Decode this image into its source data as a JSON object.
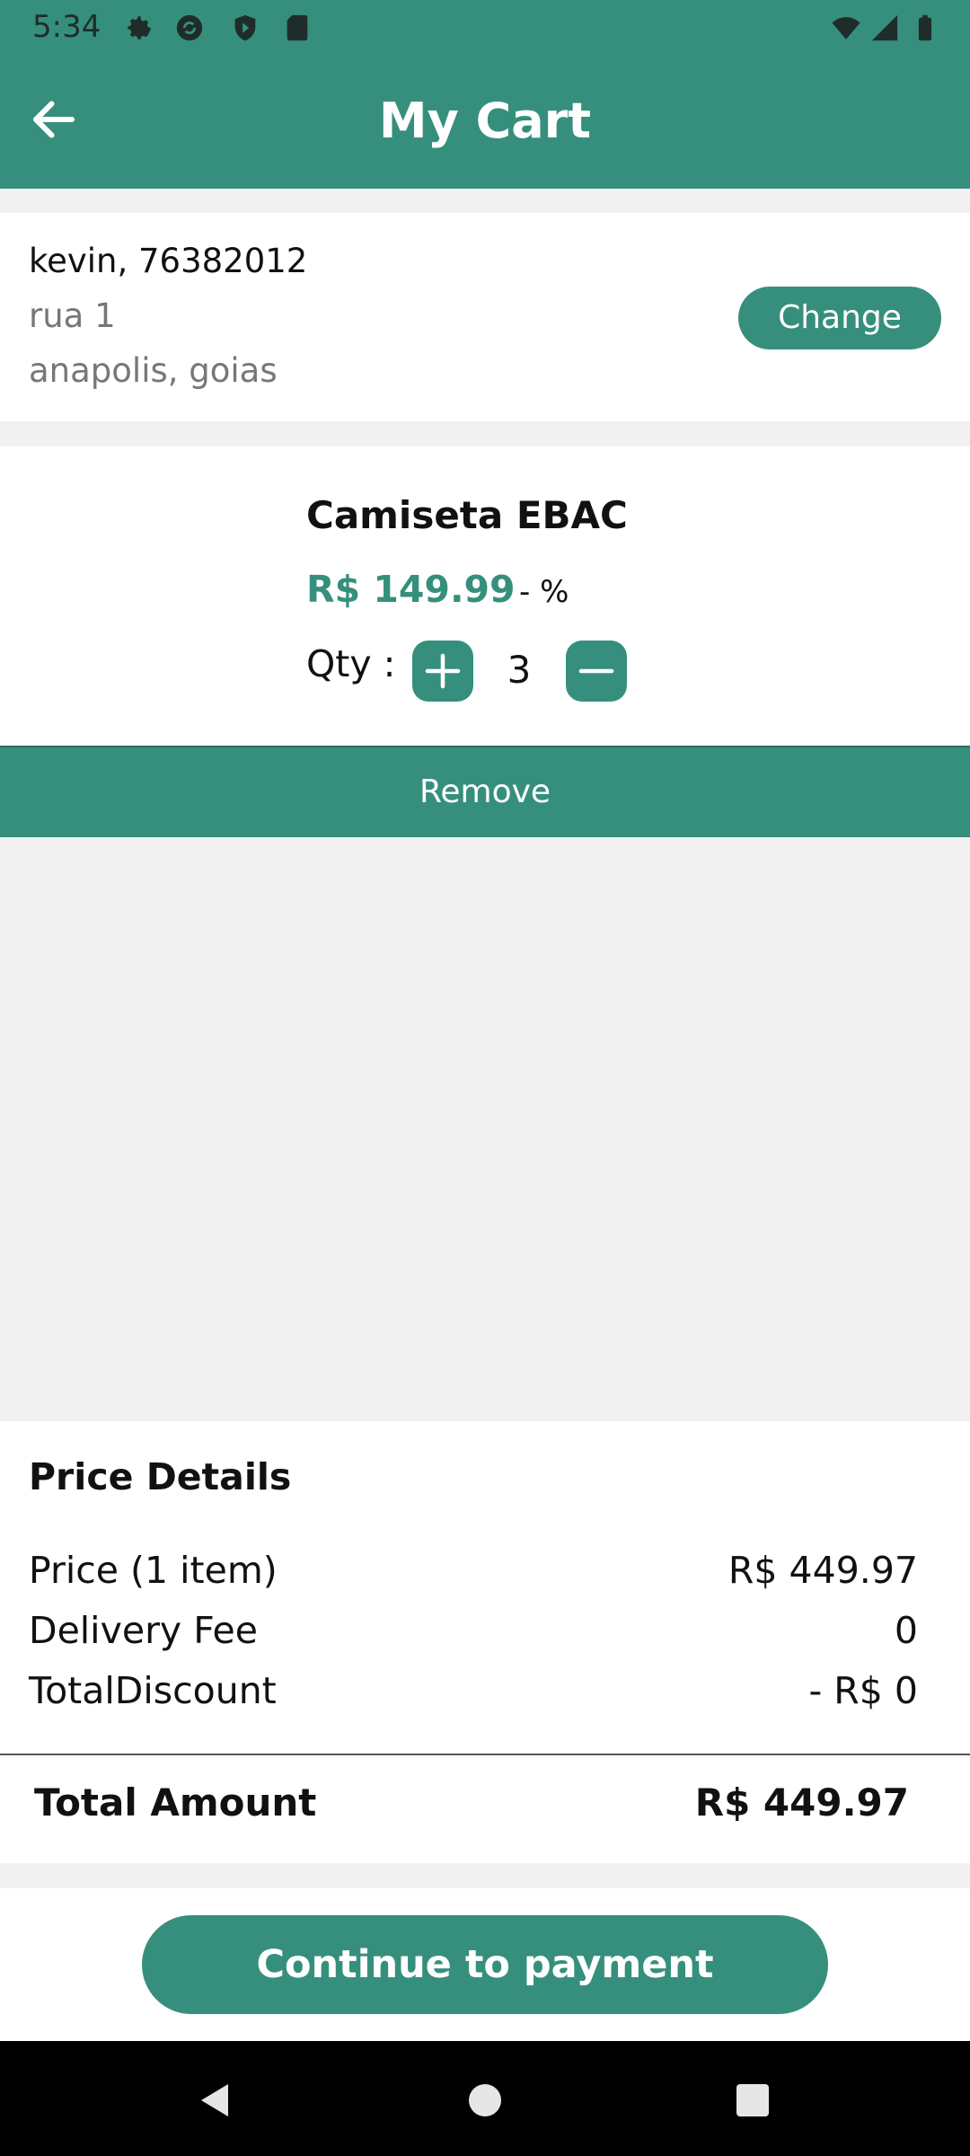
{
  "status_bar": {
    "time": "5:34"
  },
  "app_bar": {
    "title": "My Cart"
  },
  "address": {
    "name_line": "kevin, 76382012",
    "street": "rua 1",
    "city": "anapolis, goias",
    "change_label": "Change"
  },
  "item": {
    "name": "Camiseta EBAC",
    "price": "R$ 149.99",
    "discount": "- %",
    "qty_label": "Qty :",
    "qty_value": "3",
    "remove_label": "Remove"
  },
  "price_details": {
    "title": "Price Details",
    "rows": [
      {
        "label": "Price (1 item)",
        "value": "R$ 449.97"
      },
      {
        "label": "Delivery Fee",
        "value": "0"
      },
      {
        "label": "TotalDiscount",
        "value": "- R$ 0"
      }
    ],
    "total_label": "Total Amount",
    "total_value": "R$ 449.97"
  },
  "actions": {
    "continue_label": "Continue to payment"
  },
  "colors": {
    "accent": "#368f7c",
    "navbar": "#000000",
    "background": "#f1f1f1"
  }
}
